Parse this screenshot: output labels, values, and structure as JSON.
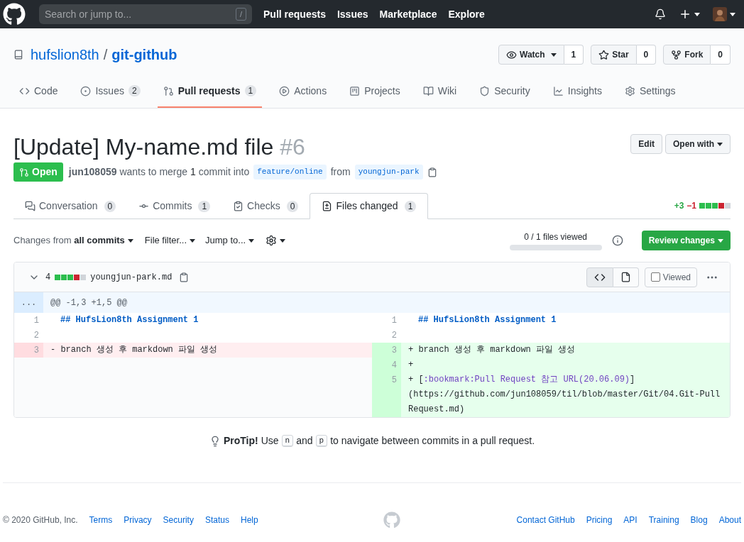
{
  "header": {
    "search": {
      "placeholder": "Search or jump to...",
      "shortcut": "/"
    },
    "nav": [
      "Pull requests",
      "Issues",
      "Marketplace",
      "Explore"
    ]
  },
  "repo": {
    "owner": "hufslion8th",
    "separator": "/",
    "name": "git-github",
    "actions": [
      {
        "kind": "watch",
        "label": "Watch",
        "count": "1"
      },
      {
        "kind": "star",
        "label": "Star",
        "count": "0"
      },
      {
        "kind": "fork",
        "label": "Fork",
        "count": "0"
      }
    ]
  },
  "repo_tabs": [
    {
      "kind": "code",
      "label": "Code",
      "selected": false
    },
    {
      "kind": "issues",
      "label": "Issues",
      "count": "2",
      "selected": false
    },
    {
      "kind": "pulls",
      "label": "Pull requests",
      "count": "1",
      "selected": true
    },
    {
      "kind": "actions",
      "label": "Actions",
      "selected": false
    },
    {
      "kind": "projects",
      "label": "Projects",
      "selected": false
    },
    {
      "kind": "wiki",
      "label": "Wiki",
      "selected": false
    },
    {
      "kind": "security",
      "label": "Security",
      "selected": false
    },
    {
      "kind": "insights",
      "label": "Insights",
      "selected": false
    },
    {
      "kind": "settings",
      "label": "Settings",
      "selected": false
    }
  ],
  "pr": {
    "title": "[Update] My-name.md file",
    "number": "#6",
    "edit": "Edit",
    "open_with": "Open with",
    "state": "Open",
    "author": "jun108059",
    "merge_text": [
      "wants to merge",
      "1",
      "commit into"
    ],
    "base": "feature/online",
    "from": "from",
    "head": "youngjun-park"
  },
  "pr_tabs": [
    {
      "kind": "conversation",
      "label": "Conversation",
      "count": "0",
      "selected": false
    },
    {
      "kind": "commits",
      "label": "Commits",
      "count": "1",
      "selected": false
    },
    {
      "kind": "checks",
      "label": "Checks",
      "count": "0",
      "selected": false
    },
    {
      "kind": "files",
      "label": "Files changed",
      "count": "1",
      "selected": true
    }
  ],
  "diffstat": {
    "added": "+3",
    "removed": "−1",
    "blocks": [
      {
        "color": "#2cbe4e"
      },
      {
        "color": "#2cbe4e"
      },
      {
        "color": "#2cbe4e"
      },
      {
        "color": "#cb2431"
      },
      {
        "color": "#d1d5da"
      }
    ]
  },
  "toolbar": {
    "changes_from": "Changes from",
    "commits": "all commits",
    "file_filter": "File filter...",
    "jump_to": "Jump to...",
    "files_viewed": "0 / 1 files viewed",
    "level": 0,
    "review": "Review changes"
  },
  "file": {
    "changes": "4",
    "blocks": [
      {
        "color": "#2cbe4e"
      },
      {
        "color": "#2cbe4e"
      },
      {
        "color": "#2cbe4e"
      },
      {
        "color": "#cb2431"
      },
      {
        "color": "#d1d5da"
      }
    ],
    "name": "youngjun-park.md",
    "viewed": {
      "label": "Viewed",
      "checked": false
    },
    "hunk_expand": "...",
    "hunk": "@@ -1,3 +1,5 @@",
    "rows": [
      {
        "left": {
          "kind": "context",
          "num": "1",
          "parts": [
            {
              "kind": "heading",
              "text": "## HufsLion8th Assignment 1"
            }
          ]
        },
        "right": {
          "kind": "context",
          "num": "1",
          "parts": [
            {
              "kind": "heading",
              "text": "## HufsLion8th Assignment 1"
            }
          ]
        }
      },
      {
        "left": {
          "kind": "context",
          "num": "2"
        },
        "right": {
          "kind": "context",
          "num": "2"
        }
      },
      {
        "left": {
          "kind": "deletion",
          "num": "3",
          "parts": [
            {
              "kind": "plain",
              "text": "- branch 생성 후 markdown 파일 생성"
            }
          ]
        },
        "right": {
          "kind": "addition",
          "num": "3",
          "parts": [
            {
              "kind": "plain",
              "text": "+ branch 생성 후 markdown 파일 생성"
            }
          ]
        }
      },
      {
        "left": {
          "kind": "empty"
        },
        "right": {
          "kind": "addition",
          "num": "4",
          "parts": [
            {
              "kind": "plain",
              "text": "+"
            }
          ]
        }
      },
      {
        "left": {
          "kind": "empty"
        },
        "right": {
          "kind": "addition",
          "num": "5",
          "parts": [
            {
              "kind": "plain",
              "text": "+ ["
            },
            {
              "kind": "link",
              "text": ":bookmark:Pull Request 참고 URL(20.06.09)"
            },
            {
              "kind": "plain",
              "text": "]\n(https://github.com/jun108059/til/blob/master/Git/04.Git-PullRequest.md)"
            }
          ]
        }
      }
    ]
  },
  "protip": {
    "title": "ProTip!",
    "parts": [
      {
        "kind": "text",
        "text": "Use"
      },
      {
        "kind": "key",
        "text": "n"
      },
      {
        "kind": "text",
        "text": "and"
      },
      {
        "kind": "key",
        "text": "p"
      },
      {
        "kind": "text",
        "text": "to navigate between commits in a pull request."
      }
    ]
  },
  "footer": {
    "copyright": "© 2020 GitHub, Inc.",
    "left_links": [
      "Terms",
      "Privacy",
      "Security",
      "Status",
      "Help"
    ],
    "right_links": [
      "Contact GitHub",
      "Pricing",
      "API",
      "Training",
      "Blog",
      "About"
    ]
  }
}
